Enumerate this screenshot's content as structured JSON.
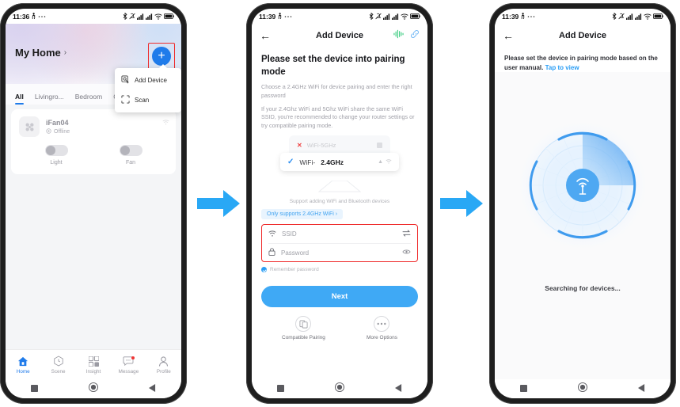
{
  "flow": {
    "arrow_color": "#29a8f5",
    "accent_blue": "#1f7bea",
    "highlight_red": "#ef2b2b"
  },
  "phone1": {
    "status": {
      "time": "11:36",
      "icons": [
        "walk-icon",
        "more-icon",
        "bluetooth-icon",
        "mute-icon",
        "signal-icon",
        "signal-icon",
        "wifi-icon",
        "battery-icon"
      ]
    },
    "header": {
      "home_name": "My Home",
      "chevron": "›",
      "add_button": "+"
    },
    "dropdown": {
      "items": [
        {
          "label": "Add Device",
          "icon": "add-device-icon",
          "highlighted": true
        },
        {
          "label": "Scan",
          "icon": "scan-icon",
          "highlighted": false
        }
      ]
    },
    "tabs": [
      {
        "label": "All",
        "active": true
      },
      {
        "label": "Livingro...",
        "active": false
      },
      {
        "label": "Bedroom",
        "active": false
      },
      {
        "label": "Ot",
        "active": false
      }
    ],
    "device_card": {
      "name": "iFan04",
      "status": "Offline",
      "controls": [
        {
          "label": "Light",
          "on": false
        },
        {
          "label": "Fan",
          "on": false
        }
      ]
    },
    "tabbar": [
      {
        "label": "Home",
        "icon": "home-icon",
        "active": true,
        "badge": false
      },
      {
        "label": "Scene",
        "icon": "scene-icon",
        "active": false,
        "badge": false
      },
      {
        "label": "Insight",
        "icon": "insight-icon",
        "active": false,
        "badge": false
      },
      {
        "label": "Message",
        "icon": "message-icon",
        "active": false,
        "badge": true
      },
      {
        "label": "Profile",
        "icon": "profile-icon",
        "active": false,
        "badge": false
      }
    ]
  },
  "phone2": {
    "status": {
      "time": "11:39"
    },
    "appbar": {
      "title": "Add Device",
      "back": "←",
      "actions": [
        "voice-wave-icon",
        "link-icon"
      ]
    },
    "heading": "Please set the device into pairing mode",
    "para1": "Choose a 2.4GHz WiFi for device pairing and enter the right password",
    "para2": "If your 2.4Ghz WiFi and 5Ghz WiFi share the same WiFi SSID, you're recommended to change your router settings or try compatible pairing mode.",
    "illustration": {
      "wifi_5ghz": "WiFi-5GHz",
      "wifi_24_prefix": "WiFi-",
      "wifi_24_bold": "2.4GHz",
      "caption": "Support adding WiFi and Bluetooth devices"
    },
    "chip": "Only supports 2.4GHz WiFi ›",
    "form": {
      "ssid_placeholder": "SSID",
      "ssid_value": "",
      "password_placeholder": "Password",
      "password_value": "",
      "remember_label": "Remember password",
      "remember_checked": true
    },
    "next_label": "Next",
    "options": [
      {
        "label": "Compatible Pairing",
        "icon": "compatible-pairing-icon"
      },
      {
        "label": "More Options",
        "icon": "more-options-icon"
      }
    ]
  },
  "phone3": {
    "status": {
      "time": "11:39"
    },
    "appbar": {
      "title": "Add Device",
      "back": "←"
    },
    "note_text": "Please set the device in pairing mode based on the user manual.",
    "note_link": "Tap to view",
    "searching_label": "Searching for devices..."
  },
  "navbar": {
    "icons": [
      "recents-square-icon",
      "home-circle-icon",
      "back-triangle-icon"
    ]
  }
}
